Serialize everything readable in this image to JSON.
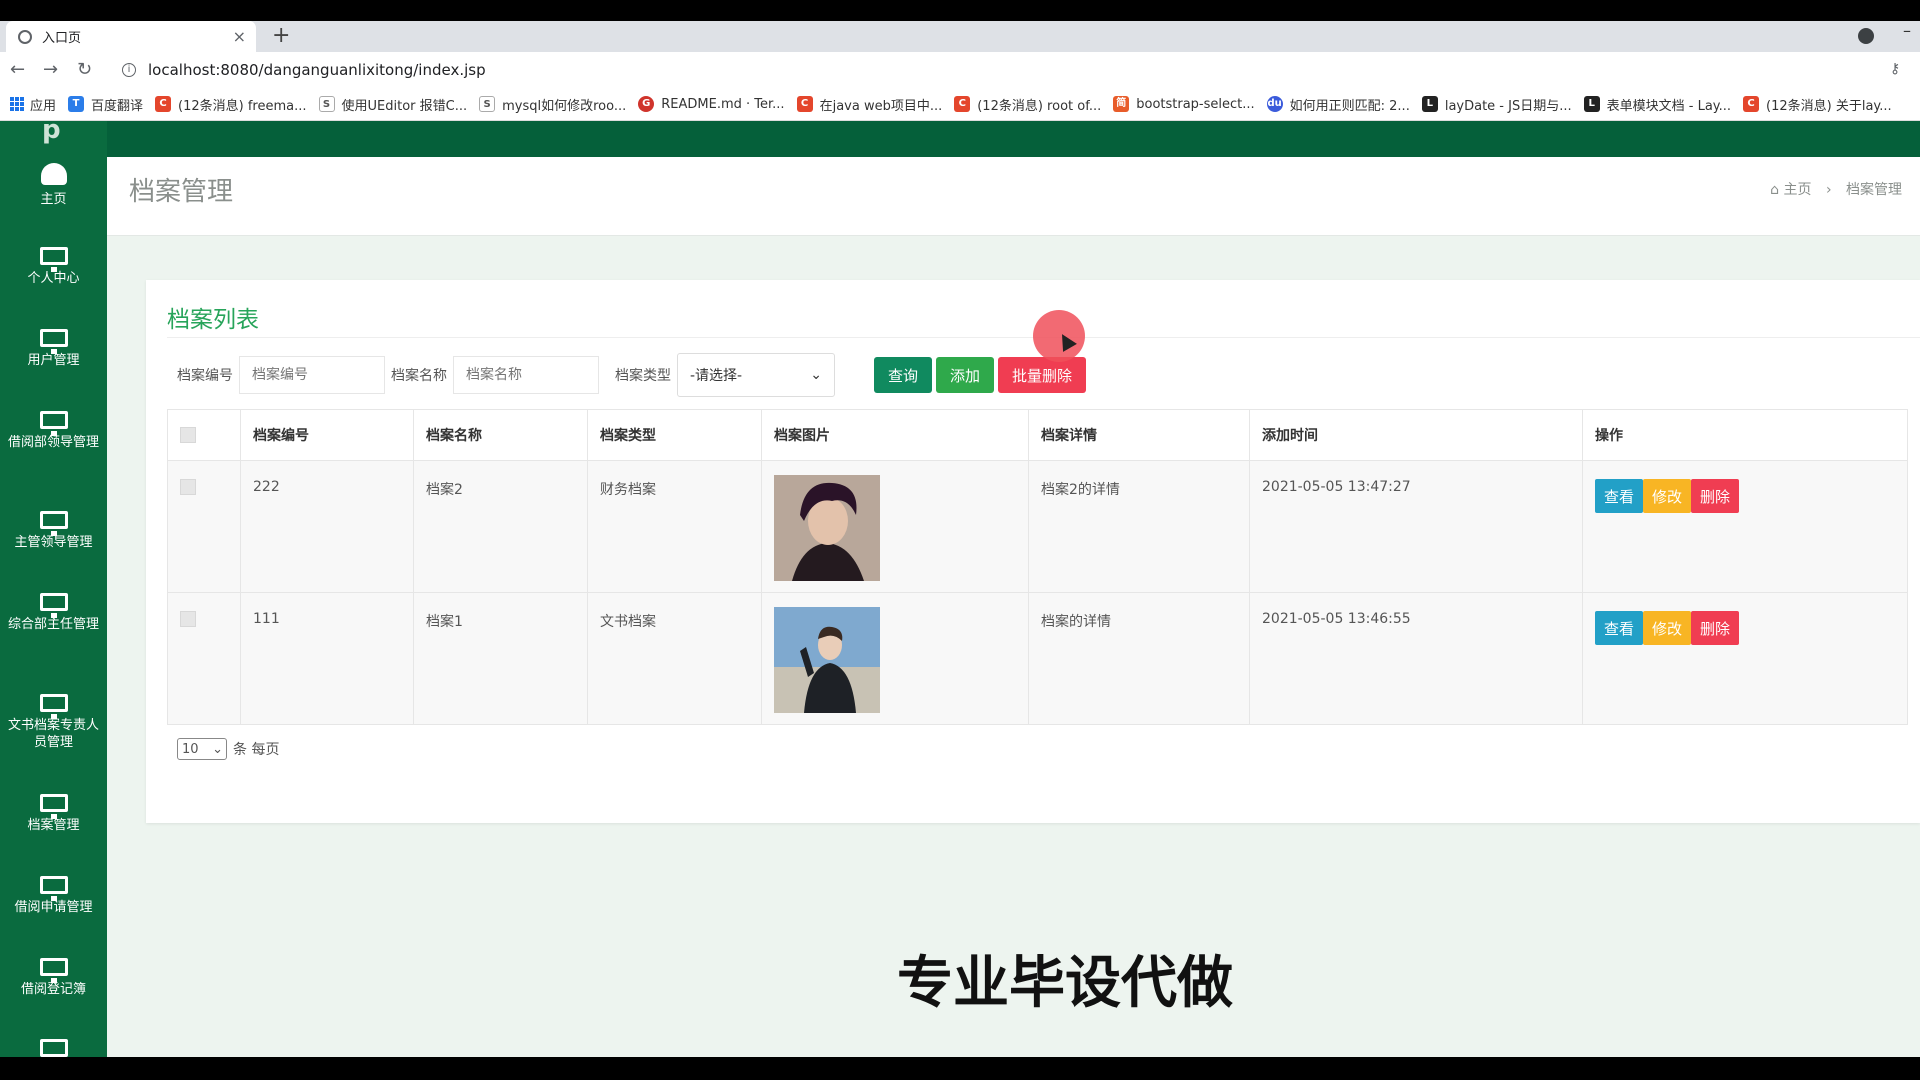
{
  "browser": {
    "tab_title": "入口页",
    "url": "localhost:8080/danganguanlixitong/index.jsp",
    "bookmarks": [
      {
        "label": "应用",
        "color": "#1a73e8"
      },
      {
        "label": "百度翻译",
        "color": "#2b7de9"
      },
      {
        "label": "(12条消息) freema...",
        "color": "#e4462c"
      },
      {
        "label": "使用UEditor 报错C...",
        "color": "#555555"
      },
      {
        "label": "mysql如何修改roo...",
        "color": "#555555"
      },
      {
        "label": "README.md · Ter...",
        "color": "#d0342c"
      },
      {
        "label": "在java web项目中...",
        "color": "#e4462c"
      },
      {
        "label": "(12条消息) root of...",
        "color": "#e4462c"
      },
      {
        "label": "bootstrap-select...",
        "color": "#e85c2a"
      },
      {
        "label": "如何用正则匹配: 2...",
        "color": "#3b5bdb"
      },
      {
        "label": "layDate - JS日期与...",
        "color": "#222222"
      },
      {
        "label": "表单模块文档 - Lay...",
        "color": "#222222"
      },
      {
        "label": "(12条消息) 关于lay...",
        "color": "#e4462c"
      }
    ]
  },
  "logo_fragment": "p",
  "sidebar": {
    "items": [
      {
        "label": "主页",
        "icon": "dashboard-icon"
      },
      {
        "label": "个人中心",
        "icon": "monitor-icon"
      },
      {
        "label": "用户管理",
        "icon": "monitor-icon"
      },
      {
        "label": "借阅部领导管理",
        "icon": "monitor-icon"
      },
      {
        "label": "主管领导管理",
        "icon": "monitor-icon"
      },
      {
        "label": "综合部主任管理",
        "icon": "monitor-icon"
      },
      {
        "label": "文书档案专责人员管理",
        "icon": "monitor-icon"
      },
      {
        "label": "档案管理",
        "icon": "monitor-icon"
      },
      {
        "label": "借阅申请管理",
        "icon": "monitor-icon"
      },
      {
        "label": "借阅登记簿",
        "icon": "monitor-icon"
      }
    ]
  },
  "header": {
    "title": "档案管理",
    "breadcrumb": {
      "home": "主页",
      "current": "档案管理"
    }
  },
  "card": {
    "title": "档案列表",
    "filters": {
      "code_label": "档案编号",
      "code_placeholder": "档案编号",
      "name_label": "档案名称",
      "name_placeholder": "档案名称",
      "type_label": "档案类型",
      "type_selected": "-请选择-"
    },
    "buttons": {
      "query": "查询",
      "add": "添加",
      "batch_delete": "批量删除"
    },
    "columns": [
      "档案编号",
      "档案名称",
      "档案类型",
      "档案图片",
      "档案详情",
      "添加时间",
      "操作"
    ],
    "rows": [
      {
        "code": "222",
        "name": "档案2",
        "type": "财务档案",
        "details": "档案2的详情",
        "added": "2021-05-05 13:47:27"
      },
      {
        "code": "111",
        "name": "档案1",
        "type": "文书档案",
        "details": "档案的详情",
        "added": "2021-05-05 13:46:55"
      }
    ],
    "row_actions": {
      "view": "查看",
      "edit": "修改",
      "delete": "删除"
    },
    "pager": {
      "per_page": "10",
      "suffix": "条 每页"
    }
  },
  "caption": "专业毕设代做"
}
